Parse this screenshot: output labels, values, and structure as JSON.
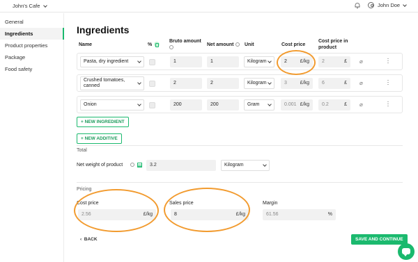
{
  "topbar": {
    "company": "John's Cafe",
    "user": "John Doe"
  },
  "sidebar": {
    "items": [
      {
        "label": "General"
      },
      {
        "label": "Ingredients"
      },
      {
        "label": "Product properties"
      },
      {
        "label": "Package"
      },
      {
        "label": "Food safety"
      }
    ]
  },
  "page": {
    "title": "Ingredients"
  },
  "table": {
    "headers": {
      "name": "Name",
      "percent": "%",
      "bruto": "Bruto amount",
      "net": "Net amount",
      "unit": "Unit",
      "cost": "Cost price",
      "cost_in_product": "Cost price in product"
    },
    "rows": [
      {
        "name": "Pasta, dry ingredient",
        "bruto": "1",
        "net": "1",
        "unit": "Kilogram",
        "cost": "2",
        "cost_unit": "£/kg",
        "cost_in_product": "2",
        "cost_in_product_unit": "£"
      },
      {
        "name": "Crushed tomatoes, canned",
        "bruto": "2",
        "net": "2",
        "unit": "Kilogram",
        "cost": "3",
        "cost_unit": "£/kg",
        "cost_in_product": "6",
        "cost_in_product_unit": "£"
      },
      {
        "name": "Onion",
        "bruto": "200",
        "net": "200",
        "unit": "Gram",
        "cost": "0.001",
        "cost_unit": "£/kg",
        "cost_in_product": "0.2",
        "cost_in_product_unit": "£"
      }
    ]
  },
  "buttons": {
    "new_ingredient": "+ NEW INGREDIENT",
    "new_additive": "+ NEW ADDITIVE",
    "back": "BACK",
    "save_continue": "SAVE AND CONTINUE"
  },
  "total": {
    "section": "Total",
    "net_weight_label": "Net weight of product",
    "net_weight_value": "3.2",
    "net_weight_unit": "Kilogram"
  },
  "pricing": {
    "section": "Pricing",
    "cost_label": "Cost price",
    "cost_value": "2.56",
    "cost_unit": "£/kg",
    "sales_label": "Sales price",
    "sales_value": "8",
    "sales_unit": "£/kg",
    "margin_label": "Margin",
    "margin_value": "61.56",
    "margin_unit": "%"
  },
  "colors": {
    "accent": "#1bb96e",
    "annotation": "#f29b2f"
  }
}
